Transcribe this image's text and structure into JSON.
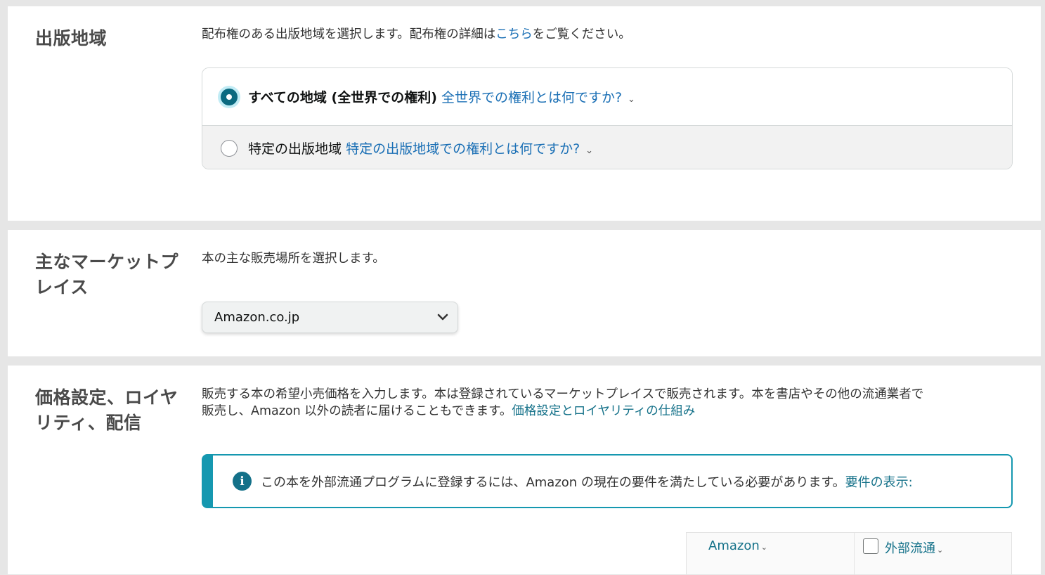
{
  "territory": {
    "title": "出版地域",
    "desc_prefix": "配布権のある出版地域を選択します。配布権の詳細は",
    "desc_link": "こちら",
    "desc_suffix": "をご覧ください。",
    "options": [
      {
        "label": "すべての地域 (全世界での権利)",
        "help_link": "全世界での権利とは何ですか?",
        "checked": true
      },
      {
        "label": "特定の出版地域",
        "help_link": "特定の出版地域での権利とは何ですか?",
        "checked": false
      }
    ]
  },
  "marketplace": {
    "title": "主なマーケットプレイス",
    "desc": "本の主な販売場所を選択します。",
    "selected": "Amazon.co.jp"
  },
  "pricing": {
    "title": "価格設定、ロイヤリティ、配信",
    "desc_line1": "販売する本の希望小売価格を入力します。本は登録されているマーケットプレイスで販売されます。本を書店やその他の流通業者で",
    "desc_line2": "販売し、Amazon 以外の読者に届けることもできます。",
    "desc_link": "価格設定とロイヤリティの仕組み",
    "alert_text": "この本を外部流通プログラムに登録するには、Amazon の現在の要件を満たしている必要があります。",
    "alert_link": "要件の表示:",
    "table_headers": [
      "Amazon",
      "外部流通"
    ]
  }
}
